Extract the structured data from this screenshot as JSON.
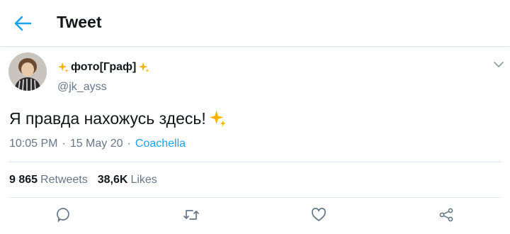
{
  "header": {
    "title": "Tweet",
    "back_icon": "arrow-left-icon"
  },
  "tweet": {
    "display_name": "фото[Граф]",
    "handle": "@jk_ayss",
    "text": "Я правда нахожусь здесь!",
    "time": "10:05 PM",
    "date": "15 May 20",
    "location": "Coachella",
    "separator": "·"
  },
  "stats": {
    "retweets_count": "9 865",
    "retweets_label": "Retweets",
    "likes_count": "38,6K",
    "likes_label": "Likes"
  },
  "actions": [
    "reply-icon",
    "retweet-icon",
    "like-icon",
    "share-icon"
  ],
  "colors": {
    "accent": "#1da1f2",
    "secondary_text": "#657786",
    "sparkle": "#f5b300",
    "divider": "#e1e8ed"
  }
}
